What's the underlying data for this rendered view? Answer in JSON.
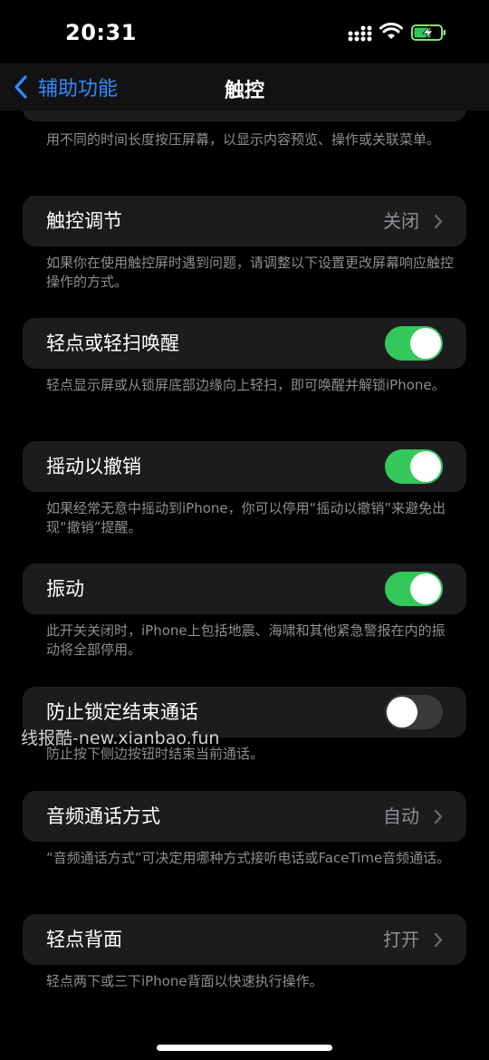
{
  "status_bar": {
    "time": "20:31"
  },
  "nav": {
    "back_label": "辅助功能",
    "title": "触控"
  },
  "top_footnote": "用不同的时间长度按压屏幕，以显示内容预览、操作或关联菜单。",
  "rows": [
    {
      "label": "触控调节",
      "value": "关闭",
      "footnote": "如果你在使用触控屏时遇到问题，请调整以下设置更改屏幕响应触控操作的方式。"
    },
    {
      "label": "轻点或轻扫唤醒",
      "toggle_on": true,
      "footnote": "轻点显示屏或从锁屏底部边缘向上轻扫，即可唤醒并解锁iPhone。"
    },
    {
      "label": "摇动以撤销",
      "toggle_on": true,
      "footnote": "如果经常无意中摇动到iPhone，你可以停用“摇动以撤销”来避免出现“撤销”提醒。"
    },
    {
      "label": "振动",
      "toggle_on": true,
      "footnote": "此开关关闭时，iPhone上包括地震、海啸和其他紧急警报在内的振动将全部停用。"
    },
    {
      "label": "防止锁定结束通话",
      "toggle_on": false,
      "footnote": "防止按下侧边按钮时结束当前通话。"
    },
    {
      "label": "音频通话方式",
      "value": "自动",
      "footnote": "“音频通话方式”可决定用哪种方式接听电话或FaceTime音频通话。"
    },
    {
      "label": "轻点背面",
      "value": "打开",
      "footnote": "轻点两下或三下iPhone背面以快速执行操作。"
    }
  ],
  "watermark": "线报酷-new.xianbao.fun",
  "colors": {
    "accent": "#2f8cff",
    "toggle_on": "#34c759",
    "toggle_off": "#3a3a3c",
    "cell_bg": "#1c1c1e",
    "secondary_text": "#8e8e93"
  }
}
